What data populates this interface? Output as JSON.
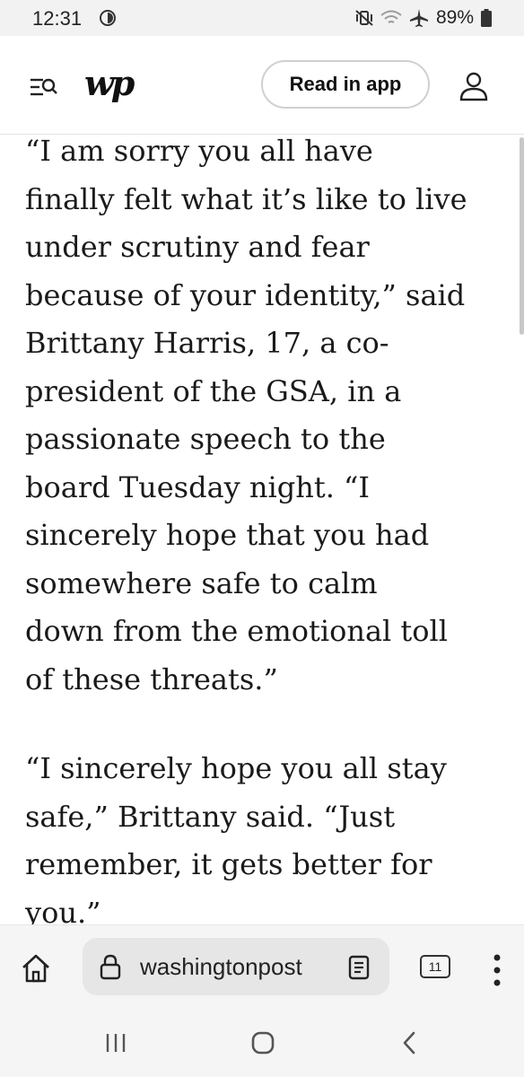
{
  "status_bar": {
    "time": "12:31",
    "battery": "89%",
    "icons": [
      "data-saver-icon",
      "mute-vibrate-icon",
      "wifi-icon",
      "airplane-icon",
      "battery-icon"
    ]
  },
  "header": {
    "logo": "wp",
    "read_in_app_label": "Read in app",
    "icons": [
      "menu-search-icon",
      "account-icon"
    ]
  },
  "article": {
    "paragraphs": [
      "“I am sorry you all have\nfinally felt what it’s like to live\nunder scrutiny and fear\nbecause of your identity,” said\nBrittany Harris, 17, a co-\npresident of the GSA, in a\npassionate speech to the\nboard Tuesday night. “I\nsincerely hope that you had\nsomewhere safe to calm\ndown from the emotional toll\nof these threats.”",
      "“I sincerely hope you all stay\nsafe,” Brittany said. “Just\nremember, it gets better for\nyou.”"
    ]
  },
  "browser_bar": {
    "url": "washingtonpost",
    "tab_count": "11",
    "icons": [
      "home-icon",
      "lock-icon",
      "reader-mode-icon",
      "tabs-icon",
      "more-options-icon"
    ]
  },
  "nav_bar": {
    "icons": [
      "recents-icon",
      "home-nav-icon",
      "back-icon"
    ]
  },
  "colors": {
    "background": "#ffffff",
    "status_bar": "#f2f2f2",
    "bottom_bar": "#f5f5f5",
    "url_box": "#e6e6e6",
    "text": "#1a1a1a"
  }
}
